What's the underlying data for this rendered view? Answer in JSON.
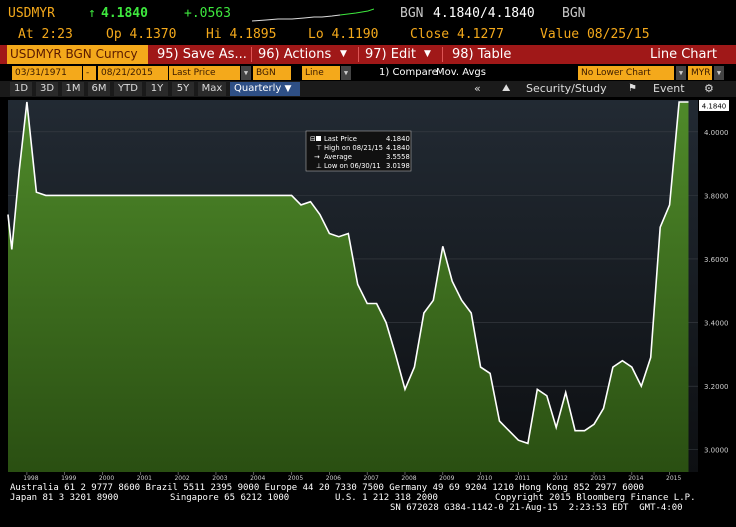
{
  "quote": {
    "ticker": "USDMYR",
    "last": "4.1840",
    "change": "+.0563",
    "bid_label": "BGN",
    "bid_ask": "4.1840/4.1840",
    "ask_label": "BGN",
    "time": "At 2:23",
    "open": "Op 4.1370",
    "high": "Hi 4.1895",
    "low": "Lo 4.1190",
    "close": "Close 4.1277",
    "value": "Value 08/25/15"
  },
  "toolbar": {
    "ticker_tab": "USDMYR BGN Curncy",
    "save": "95) Save As...",
    "actions": "96) Actions",
    "edit": "97) Edit",
    "table": "98) Table",
    "chart_type": "Line Chart"
  },
  "inputs": {
    "start_date": "03/31/1971",
    "dash": "-",
    "end_date": "08/21/2015",
    "field": "Last Price",
    "source": "BGN",
    "style": "Line",
    "compare_label": "1) Compare",
    "compare_value": "Mov. Avgs",
    "lower_chart": "No Lower Chart",
    "currency": "MYR"
  },
  "range": {
    "buttons": [
      "1D",
      "3D",
      "1M",
      "6M",
      "YTD",
      "1Y",
      "5Y",
      "Max"
    ],
    "period": "Quarterly",
    "collapse": "«",
    "security_study": "Security/Study",
    "event": "Event"
  },
  "legend": {
    "last_label": "Last Price",
    "last_value": "4.1840",
    "high_label": "High on 08/21/15",
    "high_value": "4.1840",
    "avg_label": "Average",
    "avg_value": "3.5558",
    "low_label": "Low on 06/30/11",
    "low_value": "3.0198"
  },
  "chart_data": {
    "type": "area",
    "ylim": [
      2.93,
      4.1
    ],
    "yticks": [
      "3.0000",
      "3.2000",
      "3.4000",
      "3.6000",
      "3.8000",
      "4.0000"
    ],
    "ytick_values": [
      3.0,
      3.2,
      3.4,
      3.6,
      3.8,
      4.0
    ],
    "last_label": "4.1840",
    "xticks": [
      "1998",
      "1999",
      "2000",
      "2001",
      "2002",
      "2003",
      "2004",
      "2005",
      "2006",
      "2007",
      "2008",
      "2009",
      "2010",
      "2011",
      "2012",
      "2013",
      "2014",
      "2015"
    ],
    "xtick_values": [
      1998,
      1999,
      2000,
      2001,
      2002,
      2003,
      2004,
      2005,
      2006,
      2007,
      2008,
      2009,
      2010,
      2011,
      2012,
      2013,
      2014,
      2015
    ],
    "xlim": [
      1997.5,
      2015.75
    ],
    "x": [
      1997.5,
      1997.6,
      1997.8,
      1998.0,
      1998.25,
      1998.5,
      1998.75,
      1999.0,
      2000.0,
      2001.0,
      2002.0,
      2003.0,
      2004.0,
      2004.75,
      2005.0,
      2005.25,
      2005.5,
      2005.75,
      2006.0,
      2006.25,
      2006.5,
      2006.75,
      2007.0,
      2007.25,
      2007.5,
      2007.75,
      2008.0,
      2008.25,
      2008.5,
      2008.75,
      2009.0,
      2009.25,
      2009.5,
      2009.75,
      2010.0,
      2010.25,
      2010.5,
      2010.75,
      2011.0,
      2011.25,
      2011.5,
      2011.75,
      2012.0,
      2012.25,
      2012.5,
      2012.75,
      2013.0,
      2013.25,
      2013.5,
      2013.75,
      2014.0,
      2014.25,
      2014.5,
      2014.75,
      2015.0,
      2015.25,
      2015.5
    ],
    "y": [
      3.74,
      3.63,
      3.88,
      4.14,
      3.81,
      3.8,
      3.8,
      3.8,
      3.8,
      3.8,
      3.8,
      3.8,
      3.8,
      3.8,
      3.8,
      3.77,
      3.78,
      3.74,
      3.68,
      3.67,
      3.68,
      3.52,
      3.46,
      3.46,
      3.4,
      3.3,
      3.19,
      3.26,
      3.43,
      3.47,
      3.64,
      3.53,
      3.47,
      3.43,
      3.26,
      3.24,
      3.09,
      3.06,
      3.03,
      3.02,
      3.19,
      3.17,
      3.07,
      3.18,
      3.06,
      3.06,
      3.08,
      3.13,
      3.26,
      3.28,
      3.26,
      3.2,
      3.29,
      3.7,
      3.77,
      4.18,
      4.18
    ]
  },
  "footer": {
    "line1": "Australia 61 2 9777 8600 Brazil 5511 2395 9000 Europe 44 20 7330 7500 Germany 49 69 9204 1210 Hong Kong 852 2977 6000",
    "line2a": "Japan 81 3 3201 8900",
    "line2b": "Singapore 65 6212 1000",
    "line2c": "U.S. 1 212 318 2000",
    "line2d": "Copyright 2015 Bloomberg Finance L.P.",
    "line3": "SN 672028 G384-1142-0 21-Aug-15  2:23:53 EDT  GMT-4:00"
  },
  "colors": {
    "amber": "#f4a91b",
    "toolbar_red": "#a01818",
    "area_top": "#4f8a2a",
    "area_bottom": "#2a4f12",
    "line": "#ffffff",
    "up": "#3ee83e"
  }
}
